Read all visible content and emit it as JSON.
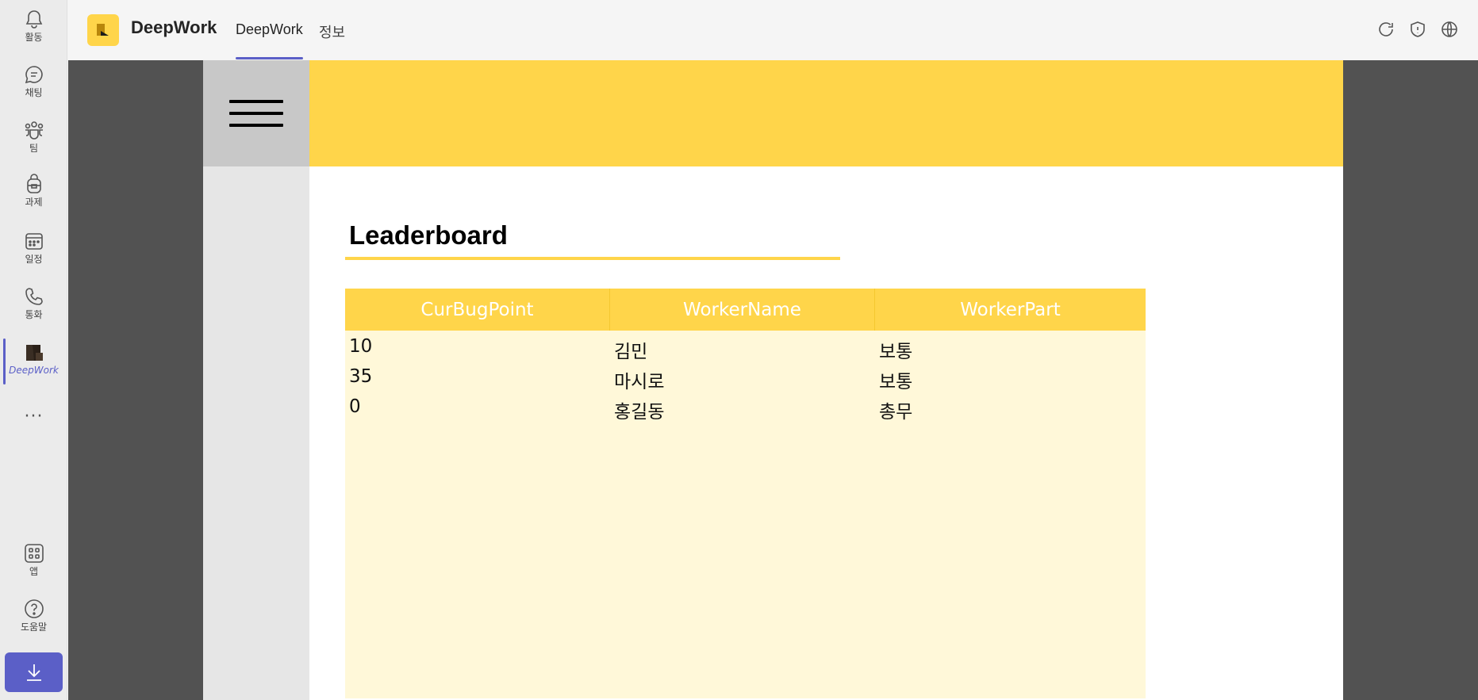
{
  "rail": {
    "items": [
      {
        "label": "활동",
        "icon": "bell-icon"
      },
      {
        "label": "채팅",
        "icon": "chat-icon"
      },
      {
        "label": "팀",
        "icon": "teams-icon"
      },
      {
        "label": "과제",
        "icon": "backpack-icon"
      },
      {
        "label": "일정",
        "icon": "calendar-icon"
      },
      {
        "label": "통화",
        "icon": "phone-icon"
      },
      {
        "label": "DeepWork",
        "icon": "deepwork-app-icon"
      }
    ],
    "more": "···",
    "apps": {
      "label": "앱",
      "icon": "apps-grid-icon"
    },
    "help": {
      "label": "도움말",
      "icon": "help-icon"
    },
    "download_icon": "download-icon"
  },
  "header": {
    "app_title": "DeepWork",
    "tabs": [
      {
        "label": "DeepWork",
        "active": true
      },
      {
        "label": "정보",
        "active": false
      }
    ],
    "icons": [
      "refresh-icon",
      "shield-icon",
      "globe-icon"
    ]
  },
  "leaderboard": {
    "title": "Leaderboard",
    "columns": [
      "CurBugPoint",
      "WorkerName",
      "WorkerPart"
    ],
    "rows": [
      [
        "10",
        "김민",
        "보통"
      ],
      [
        "35",
        "마시로",
        "보통"
      ],
      [
        "0",
        "홍길동",
        "총무"
      ]
    ]
  },
  "colors": {
    "accent": "#5b5fc7",
    "brand_yellow": "#ffd54a",
    "table_bg": "#fff8d9",
    "canvas_gray": "#525252"
  }
}
